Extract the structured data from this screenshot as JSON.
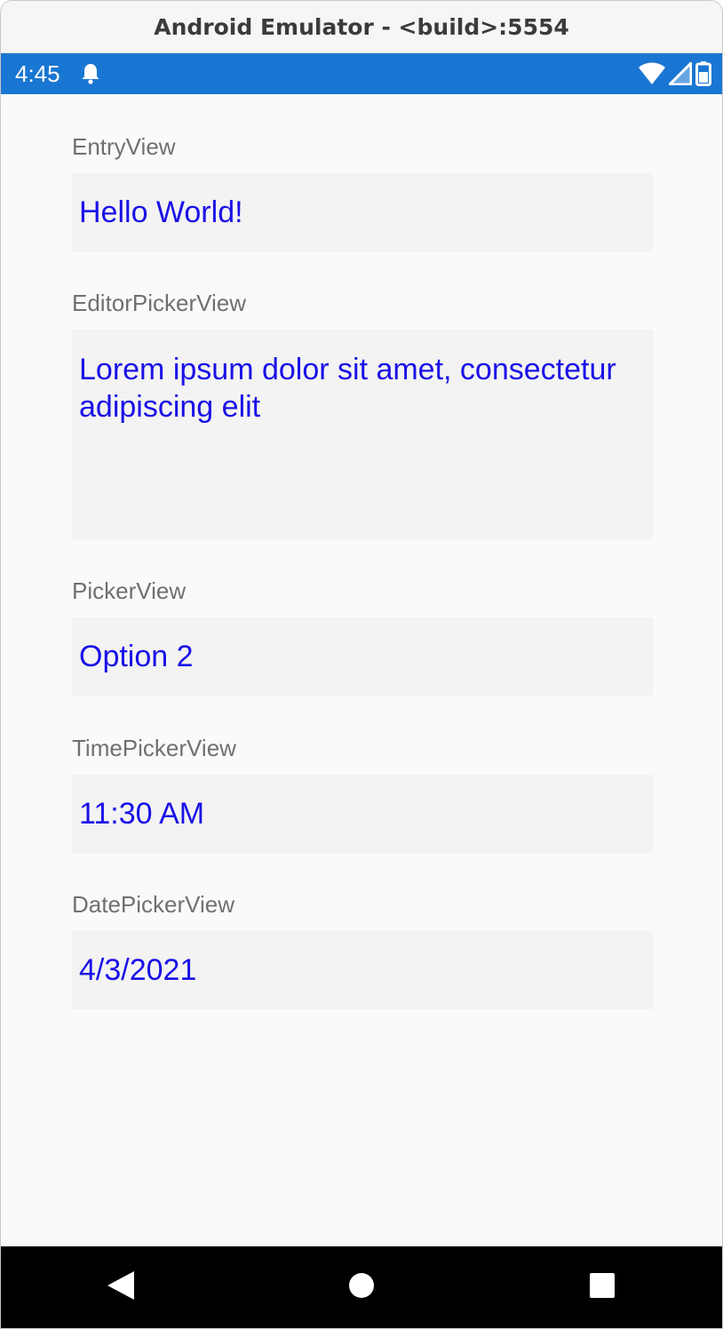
{
  "window": {
    "title": "Android Emulator - <build>:5554"
  },
  "status_bar": {
    "time": "4:45",
    "icons": [
      "notification-bell-icon",
      "wifi-icon",
      "signal-icon",
      "battery-icon"
    ],
    "background_color": "#1976d2"
  },
  "form": {
    "fields": [
      {
        "label": "EntryView",
        "value": "Hello World!"
      },
      {
        "label": "EditorPickerView",
        "value": "Lorem ipsum dolor sit amet, consectetur adipiscing elit"
      },
      {
        "label": "PickerView",
        "value": "Option 2"
      },
      {
        "label": "TimePickerView",
        "value": "11:30 AM"
      },
      {
        "label": "DatePickerView",
        "value": "4/3/2021"
      }
    ],
    "value_color": "#1a10e6",
    "label_color": "#707070",
    "field_background": "#f3f3f3"
  },
  "nav_bar": {
    "buttons": [
      "back-icon",
      "home-icon",
      "recents-icon"
    ]
  }
}
